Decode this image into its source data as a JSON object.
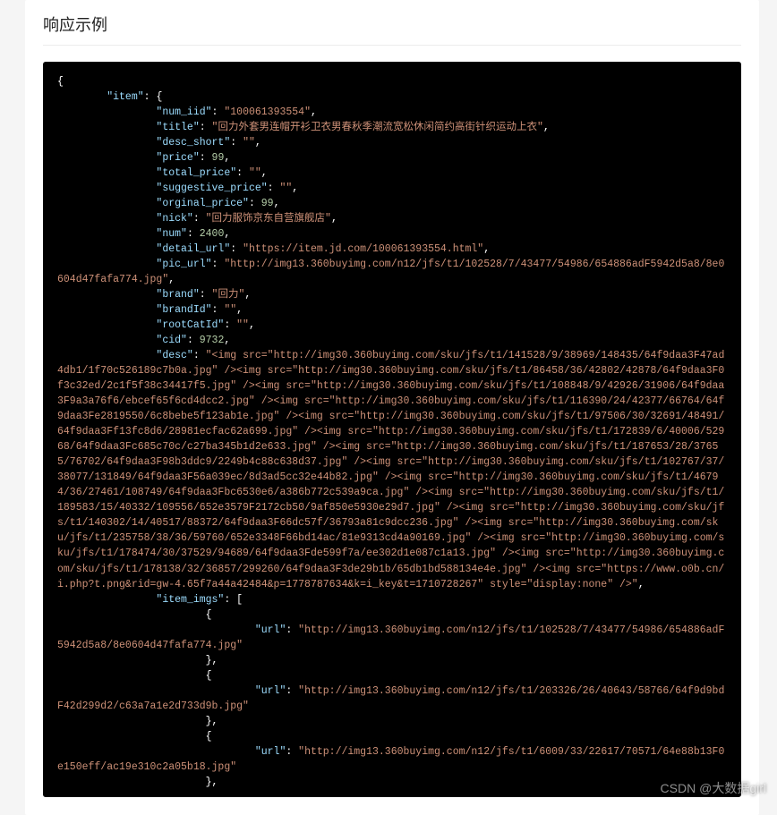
{
  "heading": "响应示例",
  "watermark": "CSDN @大数据girl",
  "code_json": {
    "item": {
      "num_iid": "100061393554",
      "title": "回力外套男连帽开衫卫衣男春秋季潮流宽松休闲简约高街针织运动上衣",
      "desc_short": "",
      "price": 99,
      "total_price": "",
      "suggestive_price": "",
      "orginal_price": 99,
      "nick": "回力服饰京东自营旗舰店",
      "num": 2400,
      "detail_url": "https://item.jd.com/100061393554.html",
      "pic_url": "http://img13.360buyimg.com/n12/jfs/t1/102528/7/43477/54986/654886adF5942d5a8/8e0604d47fafa774.jpg",
      "brand": "回力",
      "brandId": "",
      "rootCatId": "",
      "cid": 9732,
      "desc": "<img src=\"http://img30.360buyimg.com/sku/jfs/t1/141528/9/38969/148435/64f9daa3F47ad4db1/1f70c526189c7b0a.jpg\" /><img src=\"http://img30.360buyimg.com/sku/jfs/t1/86458/36/42802/42878/64f9daa3F0f3c32ed/2c1f5f38c34417f5.jpg\" /><img src=\"http://img30.360buyimg.com/sku/jfs/t1/108848/9/42926/31906/64f9daa3F9a3a76f6/ebcef65f6cd4dcc2.jpg\" /><img src=\"http://img30.360buyimg.com/sku/jfs/t1/116390/24/42377/66764/64f9daa3Fe2819550/6c8bebe5f123ab1e.jpg\" /><img src=\"http://img30.360buyimg.com/sku/jfs/t1/97506/30/32691/48491/64f9daa3Ff13fc8d6/28981ecfac62a699.jpg\" /><img src=\"http://img30.360buyimg.com/sku/jfs/t1/172839/6/40006/52968/64f9daa3Fc685c70c/c27ba345b1d2e633.jpg\" /><img src=\"http://img30.360buyimg.com/sku/jfs/t1/187653/28/37655/76702/64f9daa3F98b3ddc9/2249b4c88c638d37.jpg\" /><img src=\"http://img30.360buyimg.com/sku/jfs/t1/102767/37/38077/131849/64f9daa3F56a039ec/8d3ad5cc32e44b82.jpg\" /><img src=\"http://img30.360buyimg.com/sku/jfs/t1/46794/36/27461/108749/64f9daa3Fbc6530e6/a386b772c539a9ca.jpg\" /><img src=\"http://img30.360buyimg.com/sku/jfs/t1/189583/15/40332/109556/652e3579F2172cb50/9af850e5930e29d7.jpg\" /><img src=\"http://img30.360buyimg.com/sku/jfs/t1/140302/14/40517/88372/64f9daa3F66dc57f/36793a81c9dcc236.jpg\" /><img src=\"http://img30.360buyimg.com/sku/jfs/t1/235758/38/36/59760/652e3348F66bd14ac/81e9313cd4a90169.jpg\" /><img src=\"http://img30.360buyimg.com/sku/jfs/t1/178474/30/37529/94689/64f9daa3Fde599f7a/ee302d1e087c1a13.jpg\" /><img src=\"http://img30.360buyimg.com/sku/jfs/t1/178138/32/36857/299260/64f9daa3F3de29b1b/65db1bd588134e4e.jpg\" /><img src=\"https://www.o0b.cn/i.php?t.png&rid=gw-4.65f7a44a42484&p=1778787634&k=i_key&t=1710728267\" style=\"display:none\" />",
      "item_imgs": [
        {
          "url": "http://img13.360buyimg.com/n12/jfs/t1/102528/7/43477/54986/654886adF5942d5a8/8e0604d47fafa774.jpg"
        },
        {
          "url": "http://img13.360buyimg.com/n12/jfs/t1/203326/26/40643/58766/64f9d9bdF42d299d2/c63a7a1e2d733d9b.jpg"
        },
        {
          "url": "http://img13.360buyimg.com/n12/jfs/t1/6009/33/22617/70571/64e88b13F0e150eff/ac19e310c2a05b18.jpg"
        }
      ]
    }
  }
}
